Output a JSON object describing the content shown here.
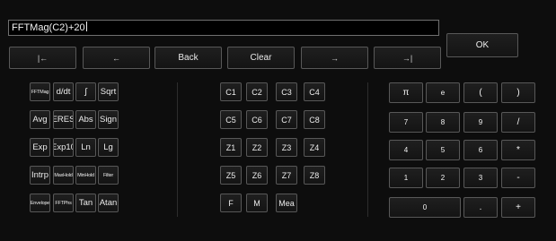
{
  "formula": {
    "value": "FFTMag(C2)+20"
  },
  "nav": {
    "home": "|←",
    "left": "←",
    "back": "Back",
    "clear": "Clear",
    "right": "→",
    "end": "→|"
  },
  "ok_label": "OK",
  "functions": [
    [
      "FFTMag",
      "d/dt",
      "∫",
      "Sqrt"
    ],
    [
      "Avg",
      "ERES",
      "Abs",
      "Sign"
    ],
    [
      "Exp",
      "Exp10",
      "Ln",
      "Lg"
    ],
    [
      "Intrp",
      "MaxHold",
      "MinHold",
      "Filter"
    ],
    [
      "Envelope",
      "FFTPhs",
      "Tan",
      "Atan"
    ]
  ],
  "sources": [
    [
      "C1",
      "C2",
      "C3",
      "C4"
    ],
    [
      "C5",
      "C6",
      "C7",
      "C8"
    ],
    [
      "Z1",
      "Z2",
      "Z3",
      "Z4"
    ],
    [
      "Z5",
      "Z6",
      "Z7",
      "Z8"
    ],
    [
      "F",
      "M",
      "Mea"
    ]
  ],
  "keypad": [
    [
      "π",
      "e",
      "(",
      ")"
    ],
    [
      "7",
      "8",
      "9",
      "/"
    ],
    [
      "4",
      "5",
      "6",
      "*"
    ],
    [
      "1",
      "2",
      "3",
      "-"
    ],
    [
      "0",
      ".",
      "+"
    ]
  ]
}
